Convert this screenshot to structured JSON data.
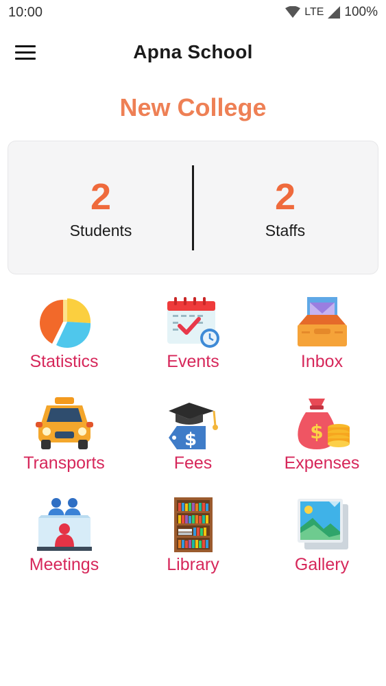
{
  "status_bar": {
    "time": "10:00",
    "network": "LTE",
    "battery": "100%"
  },
  "app_bar": {
    "title": "Apna School"
  },
  "college": {
    "name": "New College"
  },
  "stats": {
    "students": {
      "value": "2",
      "label": "Students"
    },
    "staffs": {
      "value": "2",
      "label": "Staffs"
    }
  },
  "menu_tiles": [
    {
      "label": "Statistics",
      "icon": "pie-chart-icon"
    },
    {
      "label": "Events",
      "icon": "calendar-icon"
    },
    {
      "label": "Inbox",
      "icon": "inbox-icon"
    },
    {
      "label": "Transports",
      "icon": "taxi-icon"
    },
    {
      "label": "Fees",
      "icon": "graduation-price-tag-icon"
    },
    {
      "label": "Expenses",
      "icon": "money-bag-icon"
    },
    {
      "label": "Meetings",
      "icon": "meeting-icon"
    },
    {
      "label": "Library",
      "icon": "bookshelf-icon"
    },
    {
      "label": "Gallery",
      "icon": "gallery-icon"
    }
  ],
  "colors": {
    "accent_orange": "#ef6a3c",
    "college_title": "#ee8055",
    "tile_label": "#d6275a",
    "card_bg": "#f5f5f6"
  }
}
